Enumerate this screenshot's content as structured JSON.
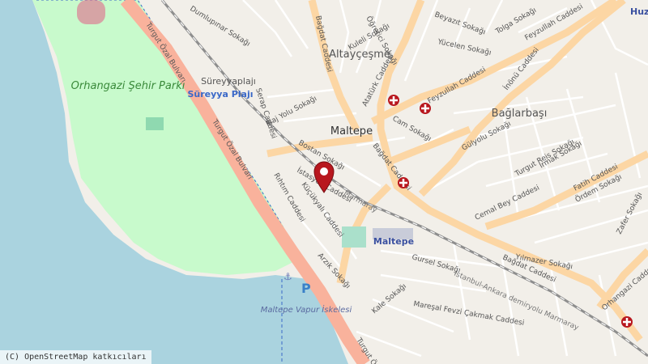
{
  "map": {
    "attribution": "(C) OpenStreetMap katkıcıları",
    "place_labels": {
      "park": "Orhangazi Şehir Parkı",
      "district_maltepe": "Maltepe",
      "neighborhood_altaycesme": "Altayçeşme",
      "neighborhood_baglarbasi": "Bağlarbaşı",
      "suadiye": "Süreyyaplajı",
      "beach": "Süreyya Plajı",
      "station": "Maltepe",
      "pier": "Maltepe Vapur İskelesi",
      "corner": "Huz"
    },
    "street_labels": [
      "Turgut Özal Bulvarı",
      "Turgut Özal Bulvarı",
      "Bağdat Caddesi",
      "Bağdat Caddesi",
      "Bağdat Caddesi",
      "Feyzullah Caddesi",
      "Feyzullah Caddesi",
      "İnönü Caddesi",
      "Atatürk Caddesi",
      "Fatih Caddesi",
      "Cemal Bey Caddesi",
      "Rıhtım Caddesi",
      "İstasyon Caddesi",
      "Marmaray",
      "İstanbul-Ankara demiryolu Marmaray",
      "Mareşal Fevzi Çakmak Caddesi",
      "Orhangazi Caddesi",
      "Dumlupınar Sokağı",
      "Plaj Yolu Sokağı",
      "Serap Caddesi",
      "Bostan Sokağı",
      "Gülyolu Sokağı",
      "Turgut Reis Sokağı",
      "Irmak Sokağı",
      "Cam Sokağı",
      "Kuleli Sokağı",
      "Öğretici Sokağı",
      "Beyazıt Sokağı",
      "Yücelen Sokağı",
      "Tolga Sokağı",
      "Gursel Sokağı",
      "Kale Sokağı",
      "Arzık Sokağı",
      "Küçükyalı Caddesi",
      "Yılmazer Sokağı",
      "Turgut Özal",
      "Ördem Sokağı",
      "Zafer Sokağı"
    ],
    "markers": {
      "location_pin": "selected-location",
      "pharmacies": 4,
      "parking_label": "P"
    },
    "colors": {
      "sea": "#aad3df",
      "park": "#c8facc",
      "land": "#f2efe9",
      "primary_road": "#fcd6a4",
      "trunk_road": "#f9b29c",
      "railway": "#8e8e8e",
      "pin": "#b8171e"
    }
  }
}
